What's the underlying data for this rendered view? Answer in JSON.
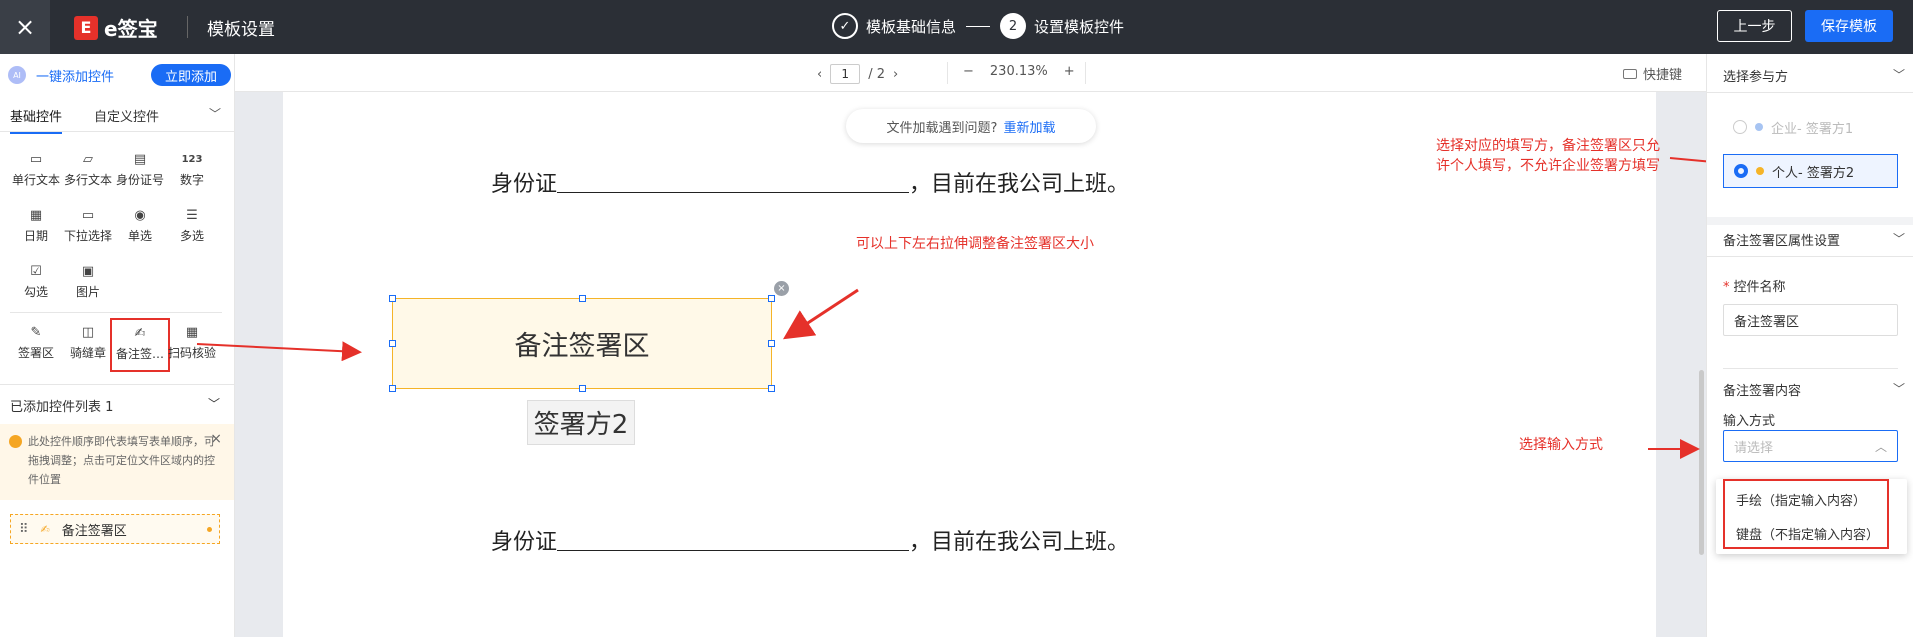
{
  "header": {
    "close_icon": "×",
    "logo_mark": "E",
    "logo_text": "e签宝",
    "title": "模板设置",
    "steps": [
      {
        "label": "模板基础信息",
        "state": "done",
        "marker": "✓"
      },
      {
        "label": "设置模板控件",
        "state": "active",
        "marker": "2"
      }
    ],
    "prev_label": "上一步",
    "save_label": "保存模板"
  },
  "left_panel": {
    "quick_add_badge": "AI",
    "quick_add_label": "一键添加控件",
    "add_now_label": "立即添加",
    "tabs": [
      {
        "label": "基础控件",
        "active": true
      },
      {
        "label": "自定义控件",
        "active": false
      }
    ],
    "tab_chevron": "﹀",
    "basic_controls": [
      {
        "label": "单行文本",
        "icon_glyph": "▭",
        "icon": "single-line-text-icon"
      },
      {
        "label": "多行文本",
        "icon_glyph": "▱",
        "icon": "multi-line-text-icon"
      },
      {
        "label": "身份证号",
        "icon_glyph": "▤",
        "icon": "id-card-icon"
      },
      {
        "label": "数字",
        "icon_glyph": "123",
        "icon": "number-icon"
      },
      {
        "label": "日期",
        "icon_glyph": "▦",
        "icon": "calendar-icon"
      },
      {
        "label": "下拉选择",
        "icon_glyph": "▭",
        "icon": "dropdown-icon"
      },
      {
        "label": "单选",
        "icon_glyph": "◉",
        "icon": "radio-icon"
      },
      {
        "label": "多选",
        "icon_glyph": "☰",
        "icon": "checklist-icon"
      },
      {
        "label": "勾选",
        "icon_glyph": "☑",
        "icon": "checkbox-icon"
      },
      {
        "label": "图片",
        "icon_glyph": "▣",
        "icon": "image-icon"
      }
    ],
    "sign_controls": [
      {
        "label": "签署区",
        "icon_glyph": "✎",
        "icon": "signature-area-icon",
        "highlighted": false
      },
      {
        "label": "骑缝章",
        "icon_glyph": "◫",
        "icon": "seam-seal-icon",
        "highlighted": false
      },
      {
        "label": "备注签…",
        "icon_glyph": "✍",
        "icon": "remark-signature-icon",
        "highlighted": true
      },
      {
        "label": "扫码核验",
        "icon_glyph": "▦",
        "icon": "qr-verify-icon",
        "highlighted": false
      }
    ],
    "added_list_title": "已添加控件列表 1",
    "added_list_chevron": "﹀",
    "tip_text": "此处控件顺序即代表填写表单顺序，可拖拽调整；点击可定位文件区域内的控件位置",
    "tip_close": "×",
    "added_item": {
      "handle": "⠿",
      "icon": "✍",
      "label": "备注签署区"
    }
  },
  "toolbar": {
    "prev_page": "‹",
    "page_current": "1",
    "page_total": "/ 2",
    "next_page": "›",
    "zoom_out": "−",
    "zoom_level": "230.13%",
    "zoom_in": "+",
    "shortcuts_label": "快捷键"
  },
  "document": {
    "reload_text": "文件加载遇到问题?",
    "reload_link": "重新加载",
    "line1_prefix": "身份证",
    "line1_suffix": "，目前在我公司上班。",
    "line2_prefix": "身份证",
    "line2_suffix": "，目前在我公司上班。",
    "signature_box_label": "备注签署区",
    "signature_close": "×",
    "signer_label": "签署方2"
  },
  "annotations": {
    "resize_hint": "可以上下左右拉伸调整备注签署区大小",
    "party_hint": "选择对应的填写方，备注签署区只允许个人填写，不允许企业签署方填写",
    "input_hint": "选择输入方式",
    "arrow_color": "#e5312a"
  },
  "right_panel": {
    "select_party_title": "选择参与方",
    "section_chevron": "﹀",
    "parties": [
      {
        "label": "企业- 签署方1",
        "selected": false,
        "dot_color": "#a7c4f2"
      },
      {
        "label": "个人- 签署方2",
        "selected": true,
        "dot_color": "#f5b428"
      }
    ],
    "props_title": "备注签署区属性设置",
    "control_name_label": "控件名称",
    "required_mark": "*",
    "control_name_value": "备注签署区",
    "content_title": "备注签署内容",
    "input_method_label": "输入方式",
    "input_method_placeholder": "请选择",
    "select_chevron": "︿",
    "options": [
      "手绘（指定输入内容）",
      "键盘（不指定输入内容）"
    ]
  },
  "colors": {
    "primary": "#1a6cf5",
    "header_bg": "#2b2f36",
    "annotation_red": "#e5312a",
    "signature_border": "#f5b428"
  }
}
